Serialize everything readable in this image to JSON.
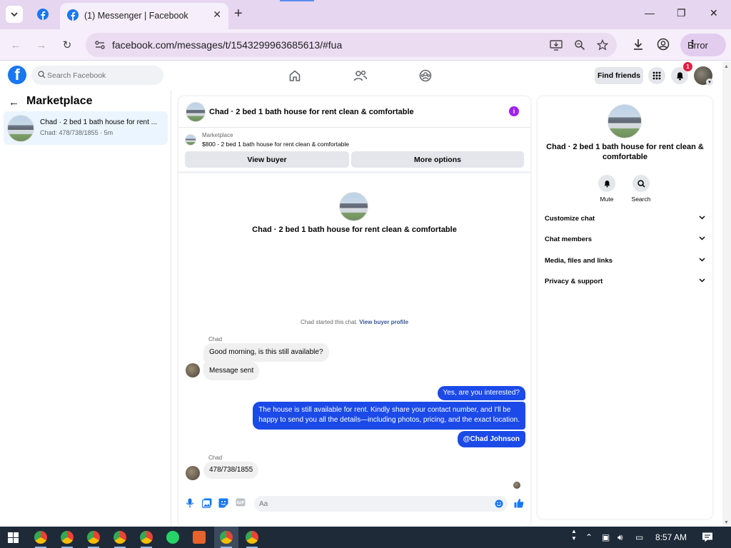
{
  "browser": {
    "tab_title": "(1) Messenger | Facebook",
    "url": "facebook.com/messages/t/1543299963685613/#fua",
    "profile_status": "Error"
  },
  "fb": {
    "search_placeholder": "Search Facebook",
    "find_friends": "Find friends",
    "notification_count": "1"
  },
  "marketplace": {
    "title": "Marketplace",
    "chat_title": "Chad · 2 bed 1 bath house for rent ...",
    "chat_sub": "Chad: 478/738/1855 · 5m"
  },
  "conversation": {
    "header_title": "Chad · 2 bed 1 bath house for rent clean & comfortable",
    "listing_label": "Marketplace",
    "listing_text": "$800 - 2 bed 1 bath house for rent clean & comfortable",
    "view_buyer": "View buyer",
    "more_options": "More options",
    "thread_title": "Chad · 2 bed 1 bath house for rent clean & comfortable",
    "started_text": "Chad started this chat.",
    "started_link": "View buyer profile",
    "sender_1": "Chad",
    "msg_in_1": "Good morning, is this still available?",
    "msg_in_2": "Message sent",
    "msg_out_1": "Yes, are you interested?",
    "msg_out_2_line1": "The house is still available for rent. Kindly share your contact number, and I'll be",
    "msg_out_2_line2": "happy to send you all the details—including photos, pricing, and the exact location.",
    "msg_out_3": "@Chad Johnson",
    "sender_2": "Chad",
    "msg_in_3": "478/738/1855",
    "composer_placeholder": "Aa"
  },
  "details": {
    "title": "Chad · 2 bed 1 bath house for rent clean & comfortable",
    "mute": "Mute",
    "search": "Search",
    "rows": [
      "Customize chat",
      "Chat members",
      "Media, files and links",
      "Privacy & support"
    ]
  },
  "taskbar": {
    "time": "8:57 AM"
  },
  "colors": {
    "fb_blue": "#1877f2",
    "outgoing_bubble": "#1b4ae8",
    "info_purple": "#a020f0"
  }
}
